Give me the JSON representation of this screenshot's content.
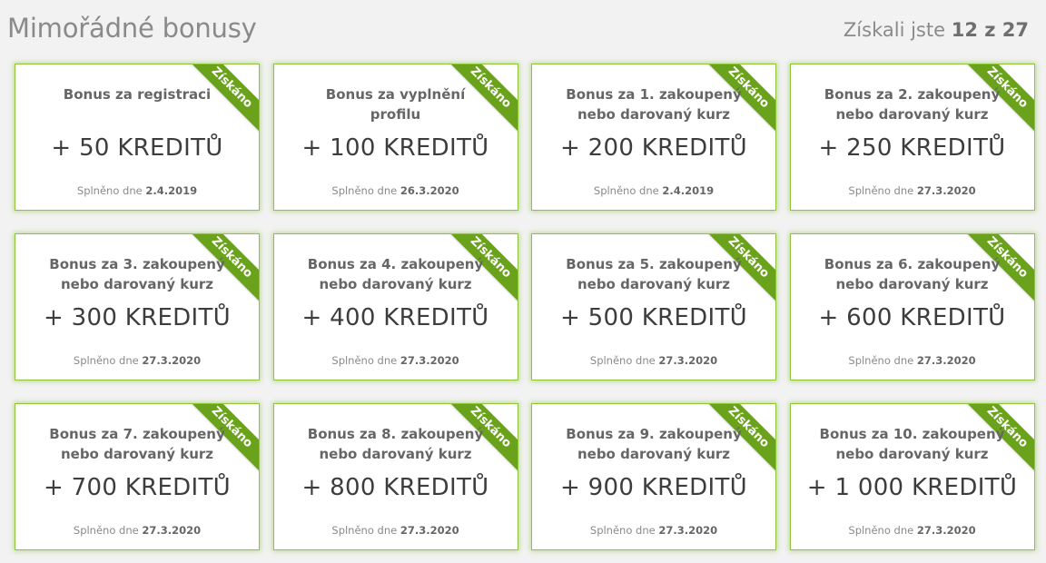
{
  "header": {
    "title": "Mimořádné bonusy",
    "progress_prefix": "Získali jste",
    "progress_value": "12 z 27"
  },
  "ribbon_label": "Získáno",
  "date_prefix": "Splněno dne",
  "colors": {
    "accent": "#8cc43c",
    "ribbon": "#6aa31b",
    "background": "#f2f2f2"
  },
  "bonuses": [
    {
      "title": "Bonus za registraci",
      "amount": "+ 50 KREDITŮ",
      "date": "2.4.2019"
    },
    {
      "title": "Bonus za vyplnění profilu",
      "amount": "+ 100 KREDITŮ",
      "date": "26.3.2020"
    },
    {
      "title": "Bonus za 1. zakoupený nebo darovaný kurz",
      "amount": "+ 200 KREDITŮ",
      "date": "2.4.2019"
    },
    {
      "title": "Bonus za 2. zakoupený nebo darovaný kurz",
      "amount": "+ 250 KREDITŮ",
      "date": "27.3.2020"
    },
    {
      "title": "Bonus za 3. zakoupený nebo darovaný kurz",
      "amount": "+ 300 KREDITŮ",
      "date": "27.3.2020"
    },
    {
      "title": "Bonus za 4. zakoupený nebo darovaný kurz",
      "amount": "+ 400 KREDITŮ",
      "date": "27.3.2020"
    },
    {
      "title": "Bonus za 5. zakoupený nebo darovaný kurz",
      "amount": "+ 500 KREDITŮ",
      "date": "27.3.2020"
    },
    {
      "title": "Bonus za 6. zakoupený nebo darovaný kurz",
      "amount": "+ 600 KREDITŮ",
      "date": "27.3.2020"
    },
    {
      "title": "Bonus za 7. zakoupený nebo darovaný kurz",
      "amount": "+ 700 KREDITŮ",
      "date": "27.3.2020"
    },
    {
      "title": "Bonus za 8. zakoupený nebo darovaný kurz",
      "amount": "+ 800 KREDITŮ",
      "date": "27.3.2020"
    },
    {
      "title": "Bonus za 9. zakoupený nebo darovaný kurz",
      "amount": "+ 900 KREDITŮ",
      "date": "27.3.2020"
    },
    {
      "title": "Bonus za 10. zakoupený nebo darovaný kurz",
      "amount": "+ 1 000 KREDITŮ",
      "date": "27.3.2020"
    }
  ]
}
